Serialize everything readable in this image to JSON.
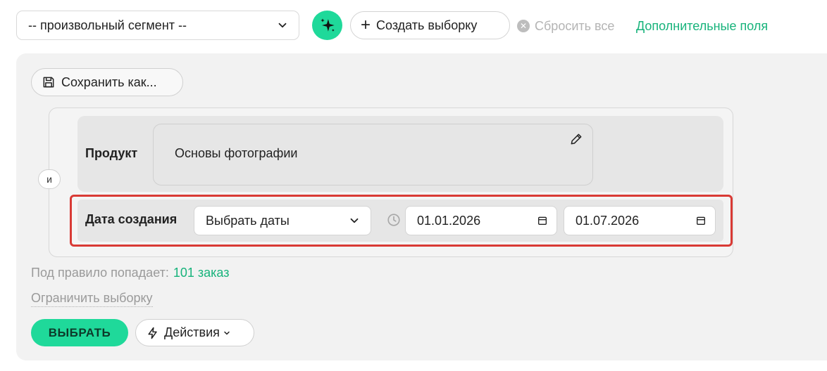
{
  "toolbar": {
    "segment_select_value": "-- произвольный сегмент --",
    "create_selection_label": "Создать выборку",
    "reset_all_label": "Сбросить все",
    "extra_fields_label": "Дополнительные поля"
  },
  "panel": {
    "save_as_label": "Сохранить как...",
    "logic_operator": "и",
    "rules": {
      "product": {
        "label": "Продукт",
        "value": "Основы фотографии"
      },
      "created_date": {
        "label": "Дата создания",
        "mode_value": "Выбрать даты",
        "date_from": "01.01.2026",
        "date_to": "01.07.2026"
      }
    },
    "matches_prefix": "Под правило попадает:",
    "matches_count": "101 заказ",
    "limit_selection_label": "Ограничить выборку",
    "select_button_label": "ВЫБРАТЬ",
    "actions_button_label": "Действия"
  },
  "colors": {
    "accent": "#1fd99a",
    "link_green": "#17b37b",
    "highlight_red": "#d93a35",
    "panel_bg": "#f2f2f2"
  }
}
